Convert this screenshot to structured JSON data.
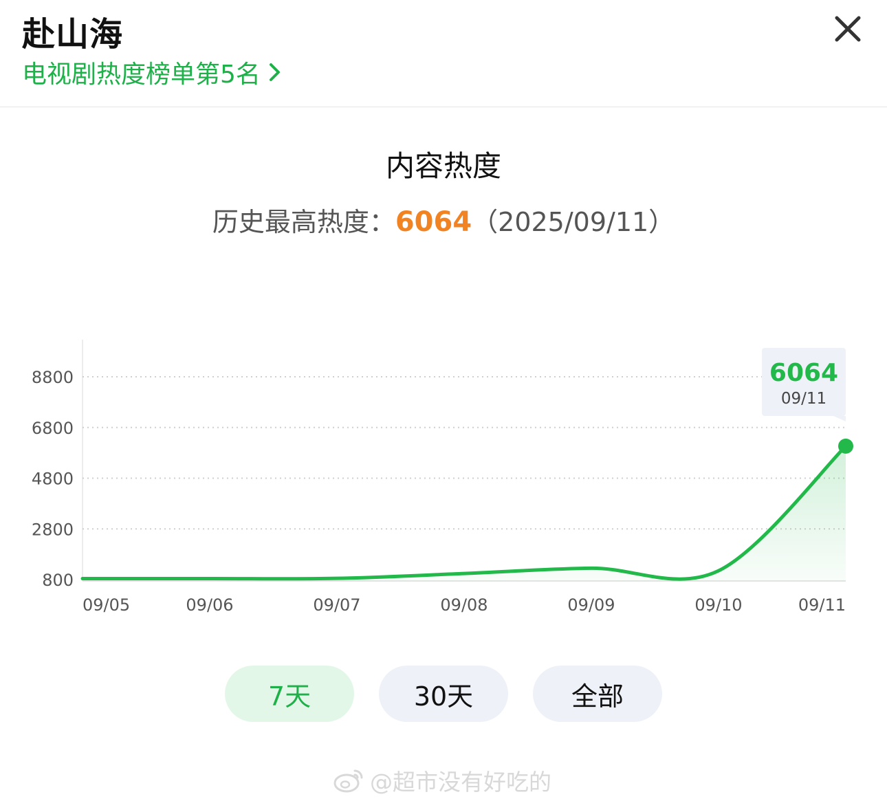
{
  "header": {
    "title": "赴山海",
    "rank_link": "电视剧热度榜单第5名"
  },
  "section": {
    "title": "内容热度",
    "peak_label": "历史最高热度：",
    "peak_value": "6064",
    "peak_date": "（2025/09/11）"
  },
  "chart_data": {
    "type": "area",
    "categories": [
      "09/05",
      "09/06",
      "09/07",
      "09/08",
      "09/09",
      "09/10",
      "09/11"
    ],
    "series": [
      {
        "values": [
          840,
          840,
          850,
          1040,
          1250,
          1150,
          6064
        ]
      }
    ],
    "ylim": [
      800,
      8800
    ],
    "yticks": [
      800,
      2800,
      4800,
      6800,
      8800
    ],
    "grid": true,
    "tooltip": {
      "value": "6064",
      "date": "09/11"
    },
    "colors": {
      "line": "#22b84a",
      "fill": "#22b84a",
      "grid": "#cfcfcf",
      "axis_text": "#555555"
    }
  },
  "filters": [
    {
      "label": "7天",
      "active": true
    },
    {
      "label": "30天",
      "active": false
    },
    {
      "label": "全部",
      "active": false
    }
  ],
  "watermark": {
    "text": "@超市没有好吃的"
  },
  "colors": {
    "accent_green": "#1fb04a",
    "peak_orange": "#f28322"
  }
}
